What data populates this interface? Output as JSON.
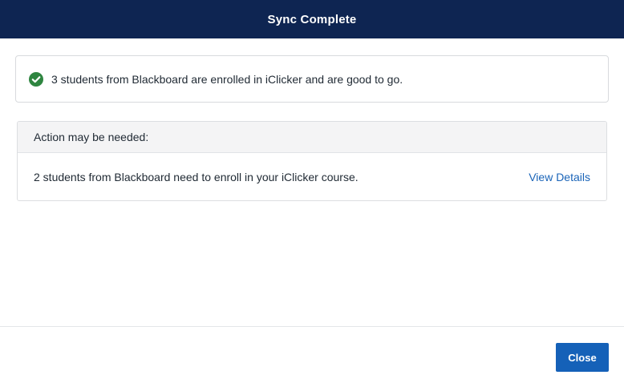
{
  "header": {
    "title": "Sync Complete"
  },
  "success": {
    "icon": "check-circle-icon",
    "message": "3 students from Blackboard are enrolled in iClicker and are good to go.",
    "color": "#2e8540"
  },
  "action_panel": {
    "heading": "Action may be needed:",
    "message": "2 students from Blackboard need to enroll in your iClicker course.",
    "link_label": "View Details"
  },
  "footer": {
    "close_label": "Close"
  },
  "colors": {
    "header_bg": "#0e2552",
    "link": "#1a64b8",
    "primary_button": "#1561b8"
  }
}
